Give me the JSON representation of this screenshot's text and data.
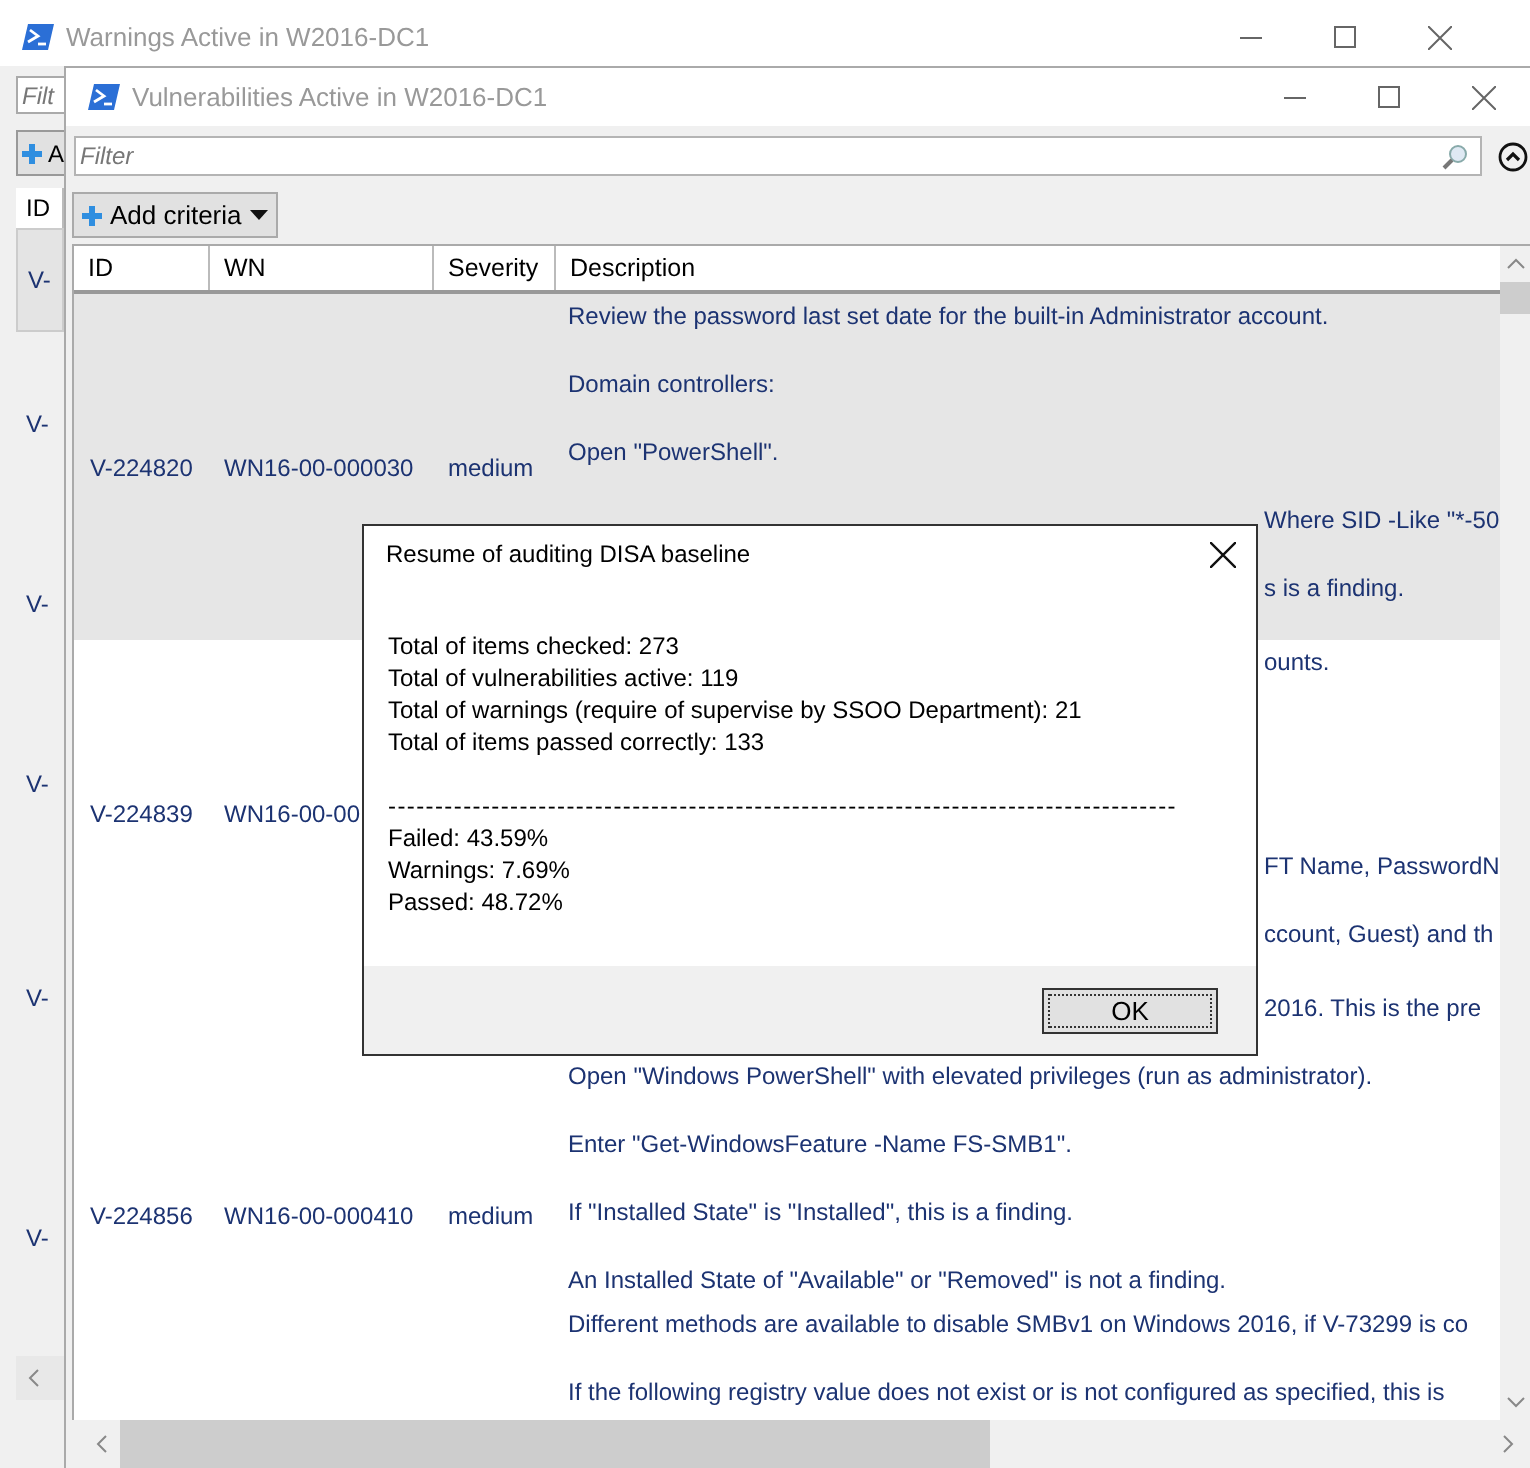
{
  "back_window": {
    "title": "Warnings Active in W2016-DC1",
    "filter": {
      "placeholder": "Filt"
    },
    "add_button": "A",
    "columns": [
      "ID"
    ],
    "rows": [
      {
        "id": "V-",
        "selected": true
      },
      {
        "id": "V-",
        "selected": false
      },
      {
        "id": "V-",
        "selected": false
      },
      {
        "id": "V-",
        "selected": false
      },
      {
        "id": "V-",
        "selected": false
      },
      {
        "id": "V-",
        "selected": false
      }
    ]
  },
  "window": {
    "title": "Vulnerabilities Active in W2016-DC1",
    "filter": {
      "placeholder": "Filter"
    },
    "add_criteria": "Add criteria",
    "columns": [
      "ID",
      "WN",
      "Severity",
      "Description"
    ],
    "rows": [
      {
        "id": "V-224820",
        "wn": "WN16-00-000030",
        "severity": "medium",
        "selected": true,
        "description": [
          {
            "lines": [
              "Review the password last set date for the built-in Administrator account."
            ]
          },
          {
            "lines": [
              "Domain controllers:"
            ]
          },
          {
            "lines": [
              "Open \"PowerShell\"."
            ]
          },
          {
            "lines": [
              "Where SID -Like \"*-50"
            ],
            "clipped": true
          },
          {
            "lines": [
              "s is a finding."
            ],
            "clipped": true
          }
        ]
      },
      {
        "id": "V-224839",
        "wn": "WN16-00-00",
        "selected": false,
        "description": [
          {
            "lines": [
              "ounts."
            ],
            "clipped": true
          },
          {
            "lines": [
              "FT Name, PasswordN"
            ],
            "clipped": true
          },
          {
            "lines": [
              "ccount, Guest) and th"
            ],
            "clipped": true
          }
        ]
      },
      {
        "id": "V-224856",
        "wn": "WN16-00-000410",
        "severity": "medium",
        "selected": false,
        "description": [
          {
            "lines": [
              "2016.  This is the pre"
            ],
            "clipped": true
          },
          {
            "lines": [
              "Open \"Windows PowerShell\" with elevated privileges (run as administrator)."
            ]
          },
          {
            "lines": [
              "Enter \"Get-WindowsFeature -Name FS-SMB1\"."
            ]
          },
          {
            "lines": [
              "If \"Installed State\" is \"Installed\", this is a finding."
            ]
          },
          {
            "lines": [
              "An Installed State of \"Available\" or \"Removed\" is not a finding.",
              "Different methods are available to disable SMBv1 on Windows 2016, if V-73299 is co"
            ]
          },
          {
            "lines": [
              "If the following registry value does not exist or is not configured as specified, this is"
            ]
          }
        ]
      }
    ]
  },
  "dialog": {
    "title": "Resume of auditing DISA baseline",
    "summary": [
      "Total of items checked: 273",
      "Total of vulnerabilities active: 119",
      "Total of warnings (require of supervise by SSOO Department): 21",
      "Total of items passed correctly: 133"
    ],
    "separator": "------------------------------------------------------------------------------------",
    "results": [
      "Failed: 43.59%",
      "Warnings: 7.69%",
      "Passed: 48.72%"
    ],
    "buttons": [
      "OK"
    ]
  }
}
